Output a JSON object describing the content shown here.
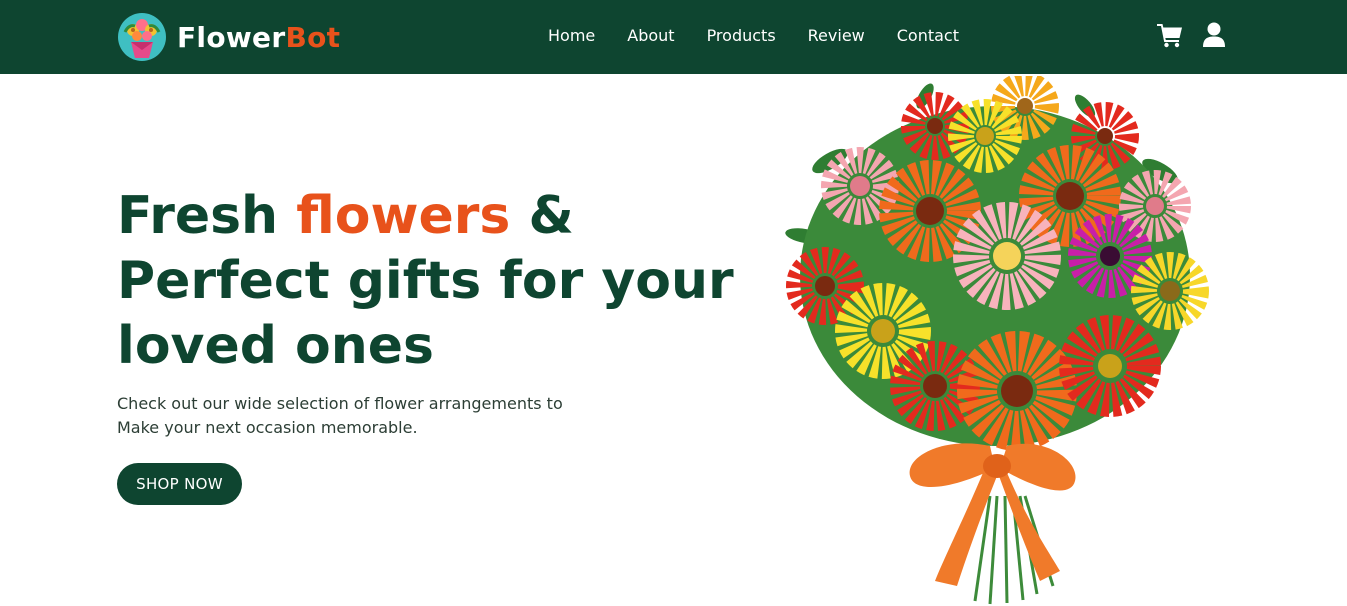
{
  "nav": {
    "brand_primary": "Flower",
    "brand_secondary": "Bot",
    "links": [
      "Home",
      "About",
      "Products",
      "Review",
      "Contact"
    ],
    "icons": [
      "cart-icon",
      "user-icon"
    ]
  },
  "hero": {
    "title_word1": "Fresh",
    "title_accent": "flowers",
    "title_rest": "& Perfect gifts for your loved ones",
    "subtitle_line1": "Check out our wide selection of flower arrangements to",
    "subtitle_line2": "Make your next occasion memorable.",
    "cta_label": "SHOP NOW"
  },
  "colors": {
    "brand_green": "#0e4530",
    "accent_orange": "#e8521b",
    "white": "#ffffff"
  }
}
